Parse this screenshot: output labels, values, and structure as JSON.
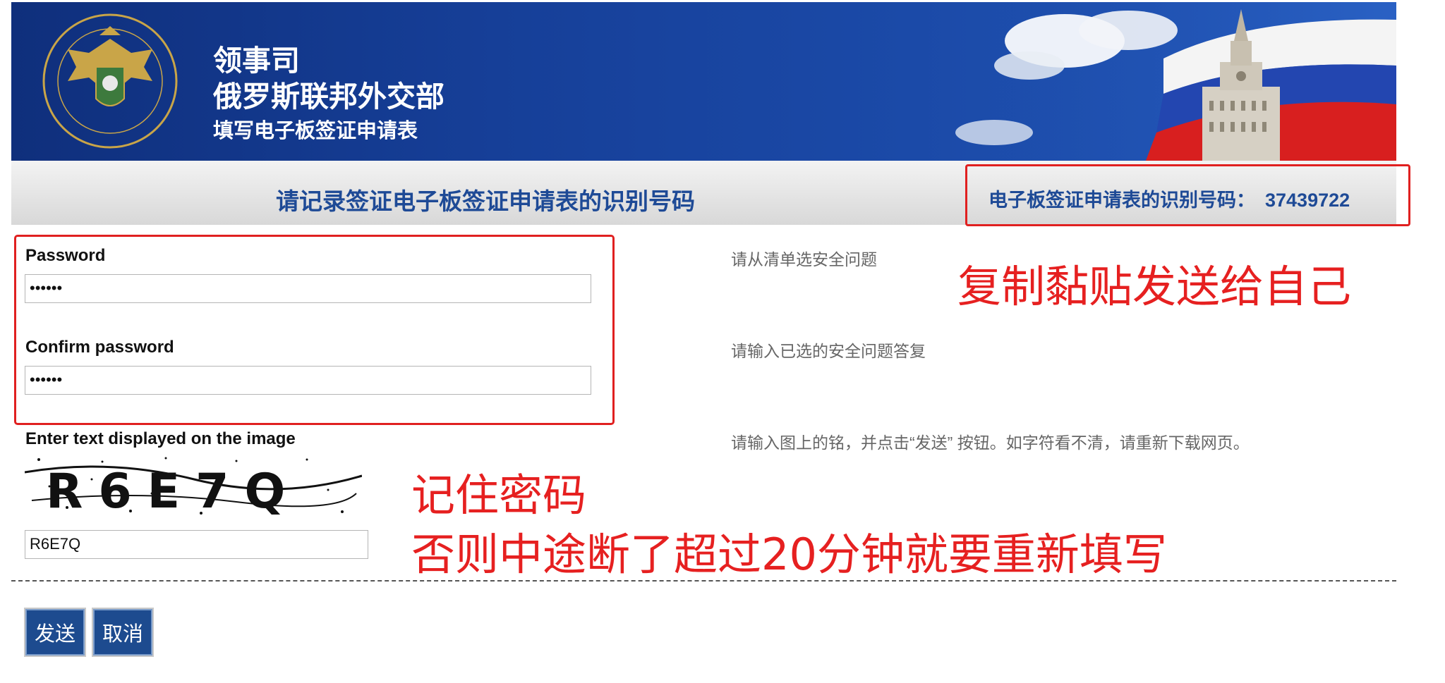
{
  "header": {
    "line1": "领事司",
    "line2": "俄罗斯联邦外交部",
    "line3": "填写电子板签证申请表"
  },
  "strip": {
    "heading": "请记录签证电子板签证申请表的识别号码",
    "id_label": "电子板签证申请表的识别号码：",
    "id_value": "37439722"
  },
  "form": {
    "password_label": "Password",
    "password_value": "••••••",
    "confirm_label": "Confirm password",
    "confirm_value": "••••••",
    "captcha_label": "Enter text displayed on the image",
    "captcha_image_text": "R6E7Q",
    "captcha_value": "R6E7Q"
  },
  "hints": {
    "security_question": "请从清单选安全问题",
    "security_answer": "请输入已选的安全问题答复",
    "captcha_hint": "请输入图上的铭，并点击“发送” 按钮。如字符看不清，请重新下载网页。"
  },
  "annotations": {
    "copy_note": "复制黏贴发送给自己",
    "remember_note": "记住密码",
    "restart_note": "否则中途断了超过20分钟就要重新填写"
  },
  "buttons": {
    "send": "发送",
    "cancel": "取消"
  },
  "colors": {
    "banner_blue": "#163f98",
    "heading_blue": "#1e4a96",
    "annotation_red": "#e62020",
    "button_blue": "#1d4b8f"
  }
}
